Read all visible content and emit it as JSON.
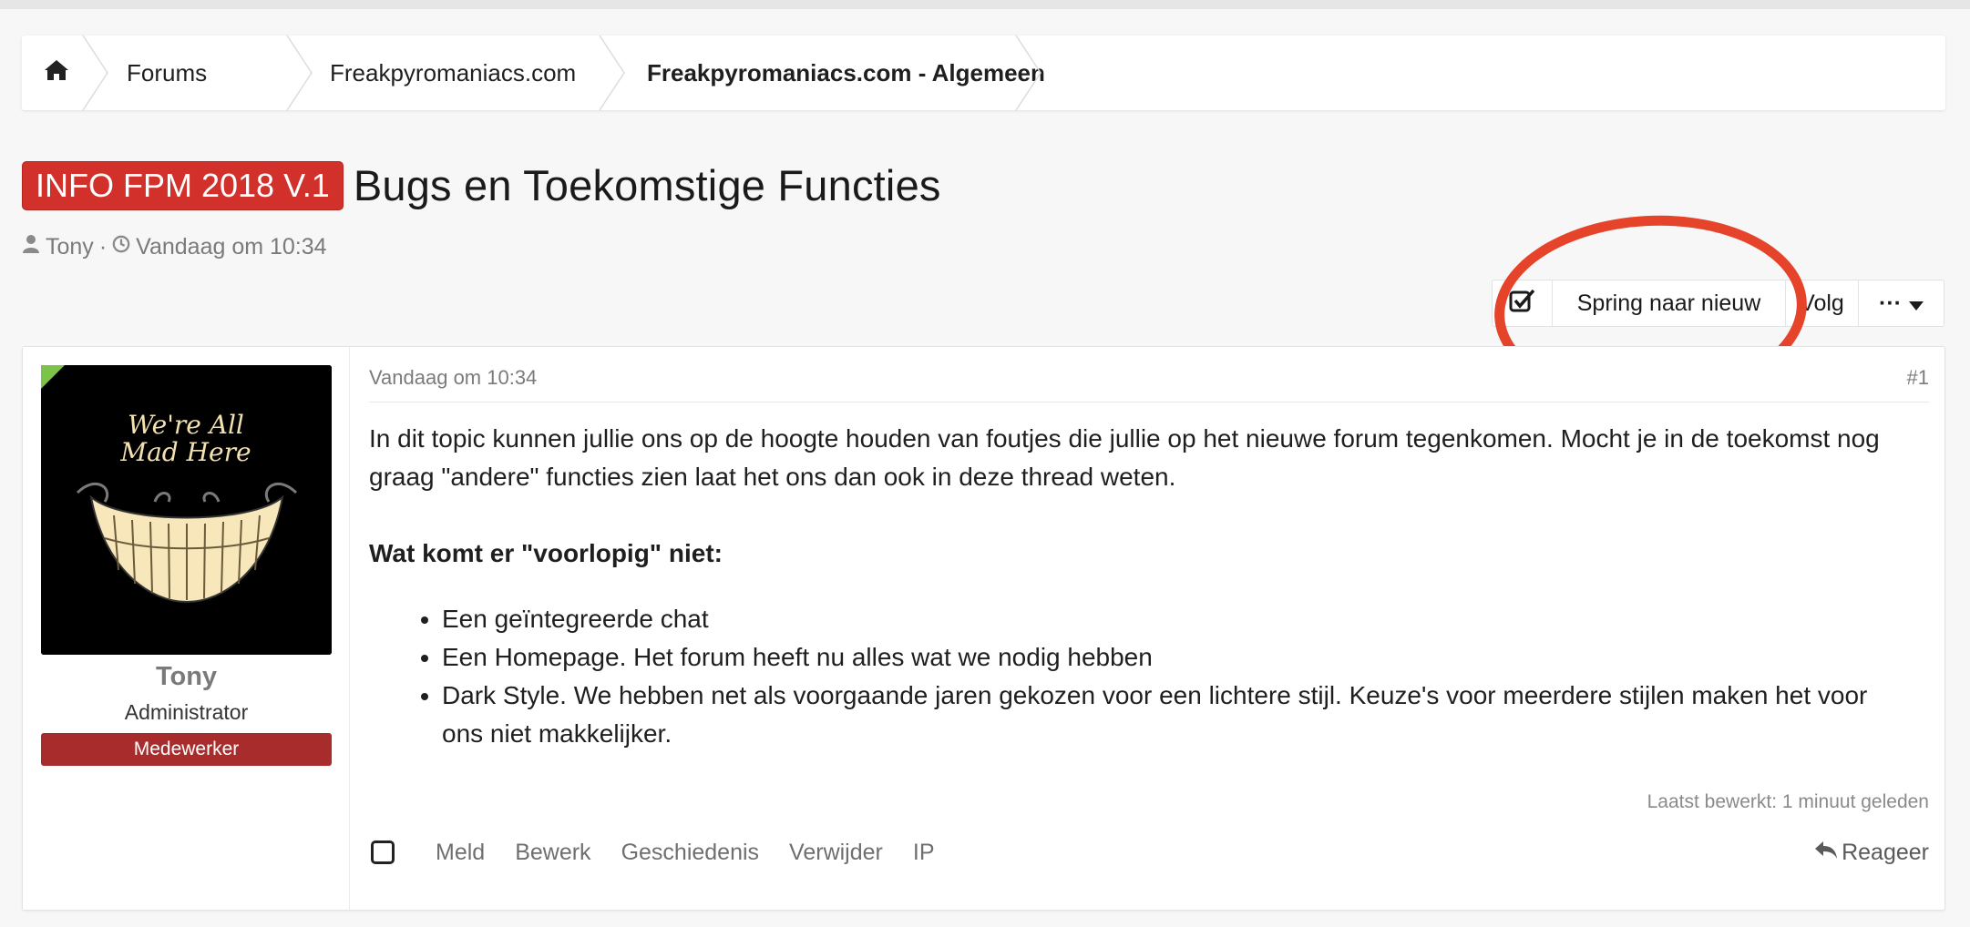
{
  "breadcrumb": {
    "home_icon": "home-icon",
    "items": [
      {
        "label": "Forums"
      },
      {
        "label": "Freakpyromaniacs.com"
      },
      {
        "label": "Freakpyromaniacs.com - Algemeen"
      }
    ]
  },
  "thread": {
    "prefix": "INFO FPM 2018 V.1",
    "title": "Bugs en Toekomstige Functies",
    "author": "Tony",
    "separator": "·",
    "date": "Vandaag om 10:34",
    "prefix_color": "#d2302a"
  },
  "actions": {
    "check_icon": "check-square-icon",
    "jump_label": "Spring naar nieuw",
    "follow_label": "Volg",
    "more_label": "···",
    "annotation_color": "#e5432a"
  },
  "post": {
    "date": "Vandaag om 10:34",
    "number": "#1",
    "user": {
      "name": "Tony",
      "title": "Administrator",
      "banner": "Medewerker",
      "banner_color": "#a92c2c"
    },
    "body": {
      "intro": "In dit topic kunnen jullie ons op de hoogte houden van foutjes die jullie op het nieuwe forum tegenkomen. Mocht je in de toekomst nog graag \"andere\" functies zien laat het ons dan ook in deze thread weten.",
      "heading": "Wat komt er \"voorlopig\" niet:",
      "items": [
        "Een geïntegreerde chat",
        "Een Homepage. Het forum heeft nu alles wat we nodig hebben",
        "Dark Style. We hebben net als voorgaande jaren gekozen voor een lichtere stijl. Keuze's voor meerdere stijlen maken het voor ons niet makkelijker."
      ]
    },
    "last_edited": "Laatst bewerkt: 1 minuut geleden",
    "footer": {
      "report": "Meld",
      "edit": "Bewerk",
      "history": "Geschiedenis",
      "delete": "Verwijder",
      "ip": "IP",
      "reply": "Reageer"
    }
  }
}
